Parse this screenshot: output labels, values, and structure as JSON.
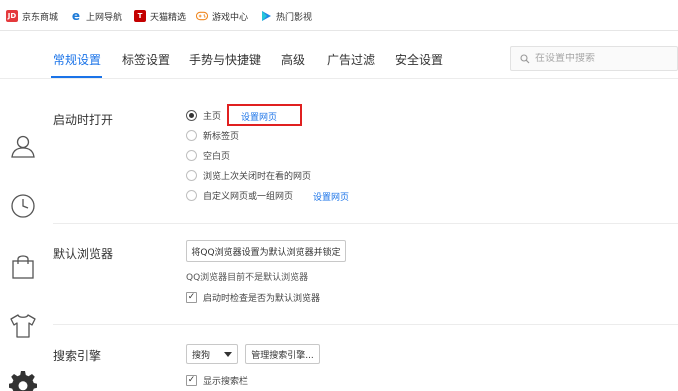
{
  "bookmarks": [
    {
      "label": "京东商城",
      "icon": "jd-icon",
      "glyph": "JD"
    },
    {
      "label": "上网导航",
      "icon": "ie-icon",
      "glyph": "e"
    },
    {
      "label": "天猫精选",
      "icon": "tmall-icon",
      "glyph": "T"
    },
    {
      "label": "游戏中心",
      "icon": "gamepad-icon",
      "glyph": ""
    },
    {
      "label": "热门影视",
      "icon": "play-icon",
      "glyph": ""
    }
  ],
  "tabs": [
    {
      "label": "常规设置",
      "active": true
    },
    {
      "label": "标签设置",
      "active": false
    },
    {
      "label": "手势与快捷键",
      "active": false
    },
    {
      "label": "高级",
      "active": false
    },
    {
      "label": "广告过滤",
      "active": false
    },
    {
      "label": "安全设置",
      "active": false
    }
  ],
  "search": {
    "placeholder": "在设置中搜索"
  },
  "rail_icons": [
    "user-icon",
    "clock-icon",
    "bag-icon",
    "shirt-icon",
    "gear-icon"
  ],
  "startup": {
    "title": "启动时打开",
    "options": [
      {
        "label": "主页",
        "checked": true,
        "link": "设置网页"
      },
      {
        "label": "新标签页",
        "checked": false,
        "link": ""
      },
      {
        "label": "空白页",
        "checked": false,
        "link": ""
      },
      {
        "label": "浏览上次关闭时在看的网页",
        "checked": false,
        "link": ""
      },
      {
        "label": "自定义网页或一组网页",
        "checked": false,
        "link": "设置网页"
      }
    ]
  },
  "default_browser": {
    "title": "默认浏览器",
    "button": "将QQ浏览器设置为默认浏览器并锁定",
    "note": "QQ浏览器目前不是默认浏览器",
    "checkbox": {
      "label": "启动时检查是否为默认浏览器",
      "checked": true
    }
  },
  "search_engine": {
    "title": "搜索引擎",
    "selected": "搜狗",
    "manage_button": "管理搜索引擎...",
    "checkbox": {
      "label": "显示搜索栏",
      "checked": true
    }
  },
  "colors": {
    "accent": "#1a73e8",
    "highlight_box": "#e02020"
  }
}
